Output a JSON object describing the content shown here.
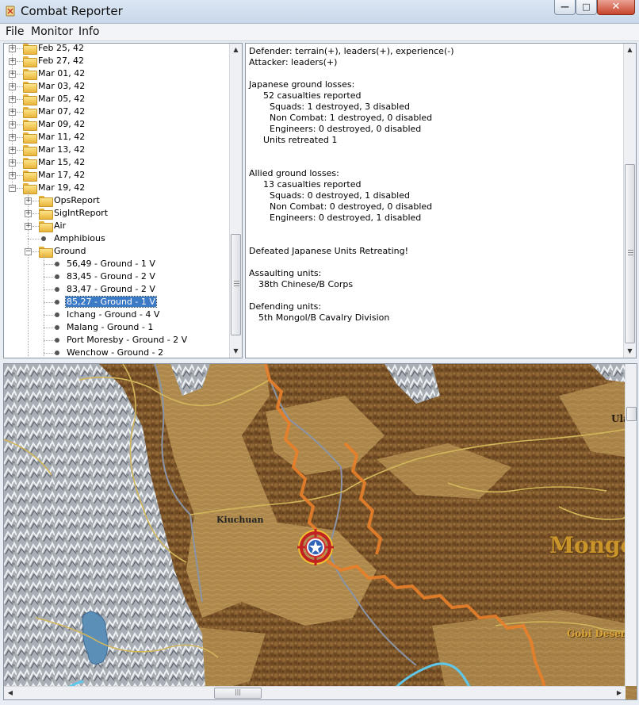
{
  "window": {
    "title": "Combat Reporter",
    "minimize_glyph": "—",
    "maximize_glyph": "□",
    "close_glyph": "✕"
  },
  "menu": [
    "File",
    "Monitor",
    "Info"
  ],
  "tree": {
    "dates": [
      "Feb 25, 42",
      "Feb 27, 42",
      "Mar 01, 42",
      "Mar 03, 42",
      "Mar 05, 42",
      "Mar 07, 42",
      "Mar 09, 42",
      "Mar 11, 42",
      "Mar 13, 42",
      "Mar 15, 42",
      "Mar 17, 42"
    ],
    "expanded_date": "Mar 19, 42",
    "children": [
      {
        "label": "OpsReport",
        "kind": "folder"
      },
      {
        "label": "SigIntReport",
        "kind": "folder"
      },
      {
        "label": "Air",
        "kind": "folder"
      },
      {
        "label": "Amphibious",
        "kind": "leaf"
      },
      {
        "label": "Ground",
        "kind": "folder-open"
      }
    ],
    "ground_items": [
      {
        "label": "56,49 - Ground - 1 V",
        "selected": false
      },
      {
        "label": "83,45 - Ground - 2 V",
        "selected": false
      },
      {
        "label": "83,47 - Ground - 2 V",
        "selected": false
      },
      {
        "label": "85,27 - Ground - 1 V",
        "selected": true
      },
      {
        "label": "Ichang  - Ground - 4 V",
        "selected": false
      },
      {
        "label": "Malang  - Ground - 1",
        "selected": false
      },
      {
        "label": "Port Moresby  - Ground - 2 V",
        "selected": false
      },
      {
        "label": "Wenchow  - Ground - 2",
        "selected": false
      }
    ],
    "expand_glyph": "+",
    "collapse_glyph": "−"
  },
  "report": {
    "lines": [
      {
        "text": "Defender: terrain(+), leaders(+), experience(-)",
        "indent": 0
      },
      {
        "text": "Attacker: leaders(+)",
        "indent": 0
      },
      {
        "text": "",
        "indent": 0
      },
      {
        "text": "Japanese ground losses:",
        "indent": 0
      },
      {
        "text": "52 casualties reported",
        "indent": 1
      },
      {
        "text": "Squads: 1 destroyed, 3 disabled",
        "indent": 2
      },
      {
        "text": "Non Combat: 1 destroyed, 0 disabled",
        "indent": 2
      },
      {
        "text": "Engineers: 0 destroyed, 0 disabled",
        "indent": 2
      },
      {
        "text": "Units retreated 1",
        "indent": 1
      },
      {
        "text": "",
        "indent": 0
      },
      {
        "text": "",
        "indent": 0
      },
      {
        "text": "Allied ground losses:",
        "indent": 0
      },
      {
        "text": "13 casualties reported",
        "indent": 1
      },
      {
        "text": "Squads: 0 destroyed, 1 disabled",
        "indent": 2
      },
      {
        "text": "Non Combat: 0 destroyed, 0 disabled",
        "indent": 2
      },
      {
        "text": "Engineers: 0 destroyed, 1 disabled",
        "indent": 2
      },
      {
        "text": "",
        "indent": 0
      },
      {
        "text": "",
        "indent": 0
      },
      {
        "text": "Defeated Japanese Units Retreating!",
        "indent": 0
      },
      {
        "text": "",
        "indent": 0
      },
      {
        "text": "Assaulting units:",
        "indent": 0
      },
      {
        "text": "38th Chinese/B Corps",
        "indent": 3
      },
      {
        "text": "",
        "indent": 0
      },
      {
        "text": "Defending units:",
        "indent": 0
      },
      {
        "text": "5th Mongol/B Cavalry Division",
        "indent": 3
      }
    ]
  },
  "map": {
    "labels": {
      "city": "Kiuchuan",
      "region": "Mongo",
      "desert": "Gobi Deser",
      "edge": "Ula"
    },
    "colors": {
      "desert": "#b08b4e",
      "forest": "#7a5428",
      "mountain": "#cfd3d8",
      "border": "#e8802a",
      "road": "#8a94a6",
      "river": "#5fc7ea",
      "lake": "#5c8fb8"
    },
    "combat_icon": "combat-target-icon"
  },
  "scroll": {
    "up": "▲",
    "down": "▼",
    "left": "◀",
    "right": "▶",
    "grip": "|||"
  }
}
